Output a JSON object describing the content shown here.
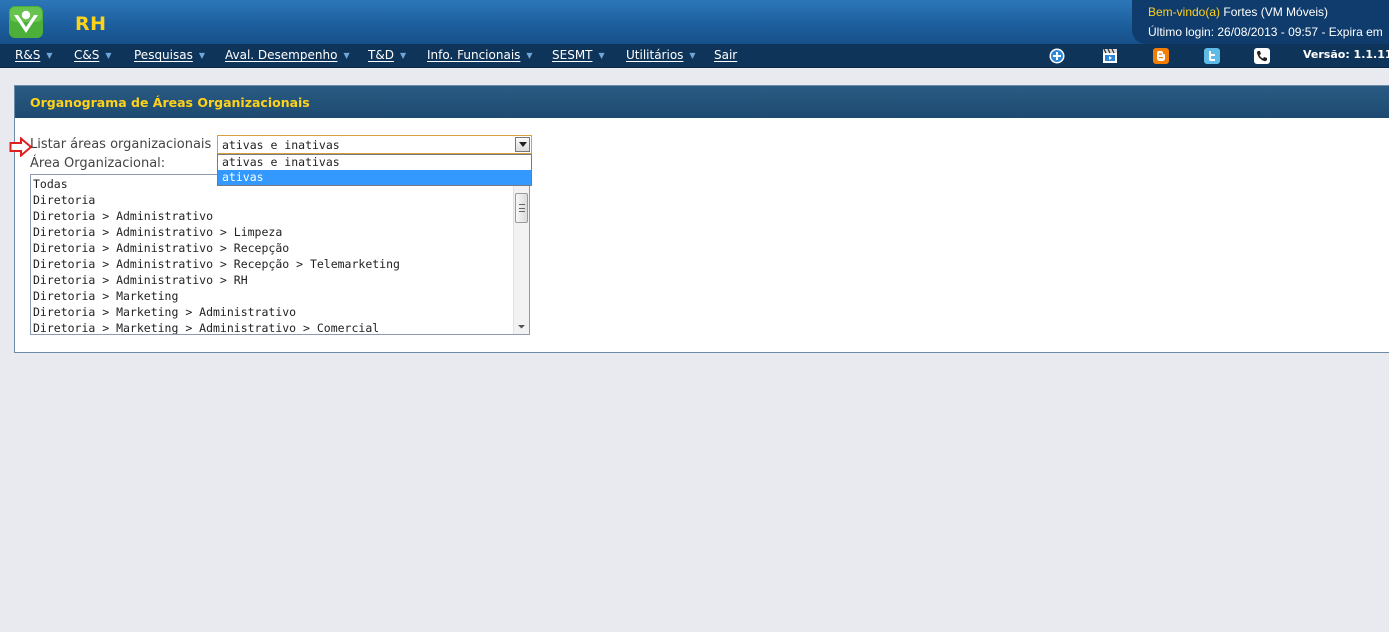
{
  "header": {
    "app_title": "RH",
    "logo_icon": "person-logo-icon",
    "welcome_prefix": "Bem-vindo(a)",
    "welcome_user": " Fortes (VM Móveis)",
    "last_login": "Último login: 26/08/2013 - 09:57  -   Expira em"
  },
  "menu": {
    "items": [
      {
        "label": "R&S"
      },
      {
        "label": "C&S"
      },
      {
        "label": "Pesquisas"
      },
      {
        "label": "Aval. Desempenho"
      },
      {
        "label": "T&D"
      },
      {
        "label": "Info. Funcionais"
      },
      {
        "label": "SESMT"
      },
      {
        "label": "Utilitários"
      },
      {
        "label": "Sair"
      }
    ],
    "toolbar_icons": [
      "plus-circle-icon",
      "video-icon",
      "blogger-icon",
      "twitter-icon",
      "phone-icon"
    ],
    "version": "Versão: 1.1.11"
  },
  "panel": {
    "title": "Organograma de Áreas Organizacionais",
    "list_label": "Listar áreas organizacionais",
    "area_label": "Área Organizacional:",
    "select_value": "ativas e inativas",
    "select_options": [
      {
        "label": "ativas e inativas",
        "selected": false
      },
      {
        "label": "ativas",
        "selected": true
      }
    ],
    "areas": [
      "Todas",
      "Diretoria",
      "Diretoria > Administrativo",
      "Diretoria > Administrativo > Limpeza",
      "Diretoria > Administrativo > Recepção",
      "Diretoria > Administrativo > Recepção > Telemarketing",
      "Diretoria > Administrativo > RH",
      "Diretoria > Marketing",
      "Diretoria > Marketing > Administrativo",
      "Diretoria > Marketing > Administrativo > Comercial"
    ]
  },
  "colors": {
    "header_blue": "#1d5f9e",
    "menu_dark": "#0f3459",
    "title_yellow": "#ffd21a",
    "selection_blue": "#3399ff",
    "select_border": "#d8a13d",
    "pointer_arrow": "#e02020"
  }
}
